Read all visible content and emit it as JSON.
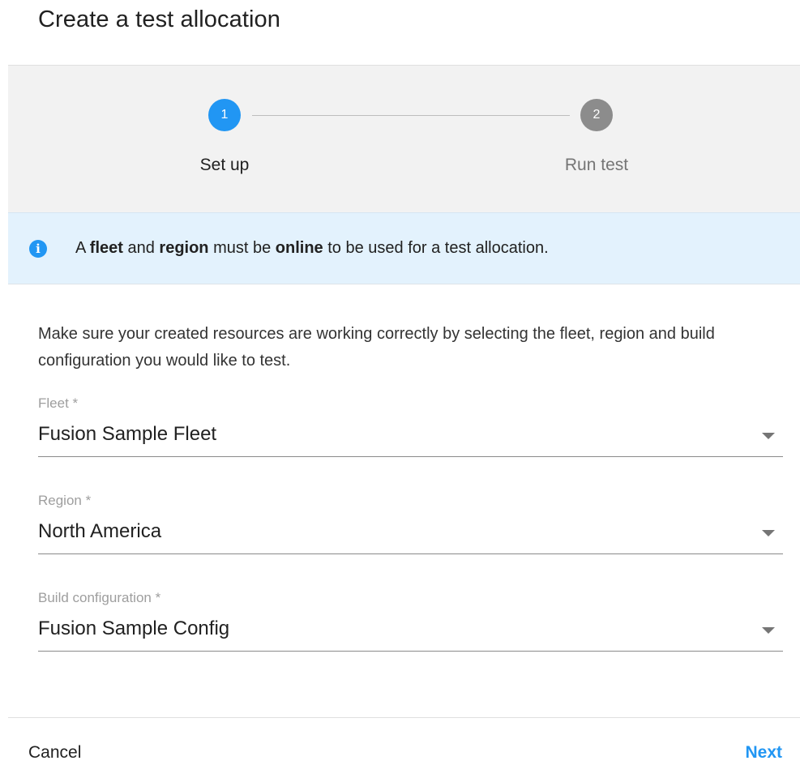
{
  "dialog": {
    "title": "Create a test allocation"
  },
  "stepper": {
    "steps": [
      {
        "number": "1",
        "label": "Set up",
        "state": "active"
      },
      {
        "number": "2",
        "label": "Run test",
        "state": "inactive"
      }
    ],
    "colors": {
      "active": "#2196f3",
      "inactive": "#8c8c8c"
    }
  },
  "info_banner": {
    "icon": "info-icon",
    "icon_glyph": "i",
    "parts": {
      "p1": "A ",
      "b1": "fleet",
      "p2": " and ",
      "b2": "region",
      "p3": " must be ",
      "b3": "online",
      "p4": " to be used for a test allocation."
    },
    "background": "#e3f2fd"
  },
  "description": "Make sure your created resources are working correctly by selecting the fleet, region and build configuration you would like to test.",
  "form": {
    "fleet": {
      "label": "Fleet *",
      "value": "Fusion Sample Fleet"
    },
    "region": {
      "label": "Region *",
      "value": "North America"
    },
    "build_configuration": {
      "label": "Build configuration *",
      "value": "Fusion Sample Config"
    }
  },
  "actions": {
    "cancel_label": "Cancel",
    "next_label": "Next",
    "accent": "#2196f3"
  }
}
